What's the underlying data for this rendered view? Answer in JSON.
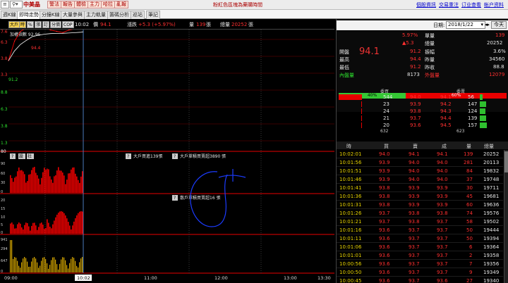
{
  "toolbar": {
    "dropdown_label": "▾",
    "search_icon": "search-icon",
    "stock_name": "中美晶",
    "buttons": [
      "警法",
      "報告",
      "體檢",
      "主力",
      "哈拉",
      "亂報"
    ],
    "marquee": "粉紅色區塊為藥購時間",
    "links": [
      "個股資訊",
      "交易重注",
      "订业查看",
      "帐户资料"
    ]
  },
  "tabs": [
    "週K線",
    "即時走勢",
    "分鐘K線",
    "大量參與",
    "主力軌量",
    "籌碼分析",
    "巡站",
    "筆記"
  ],
  "chart_toolbar": {
    "buttons": [
      "大戶",
      "時",
      "%",
      "漲",
      "訂",
      "分價",
      "COP"
    ],
    "time": "10:02",
    "price_label": "價",
    "price": "94.1",
    "change_label": "漲跌",
    "change": "+5.3 (+5.97%)",
    "volume_label": "量",
    "volume": "139",
    "volume_unit": "張",
    "total_label": "總量",
    "total": "20252",
    "total_unit": "張"
  },
  "chart": {
    "price_scale_labels": [
      "7.6",
      "6.3",
      "3.8",
      "3.3",
      "8.8",
      "6.3",
      "3.8",
      "1.3",
      "80"
    ],
    "weighted_index_label": "加權指數 92.96",
    "high_label": "94.4",
    "low_label": "91.2",
    "panel2_buttons": [
      "?",
      "設",
      "社"
    ],
    "panel2_note1": "大戶買進139張",
    "panel2_note2": "大戶單積買賣超3890 張",
    "panel2_scale": [
      "90",
      "60",
      "30",
      "0"
    ],
    "panel3_note": "散戶單積買賣超16 張",
    "panel3_scale": [
      "20",
      "15",
      "10",
      "5",
      "0"
    ],
    "panel4_scale": [
      "941",
      "294",
      "647",
      "0"
    ],
    "time_labels": [
      "09:00",
      "10:02",
      "11:00",
      "12:00",
      "13:00",
      "13:30"
    ],
    "colors": {
      "accent_red": "#e80000",
      "price_line": "#ffffff",
      "avg_line": "#e8d300"
    }
  },
  "chart_data": {
    "type": "line",
    "title": "",
    "xlabel": "",
    "ylabel": "",
    "series": [
      {
        "name": "price",
        "x": [
          "09:00",
          "09:05",
          "09:10",
          "09:15",
          "09:20",
          "09:25",
          "09:30",
          "09:35",
          "09:40",
          "09:45",
          "09:50",
          "09:55",
          "10:00",
          "10:02"
        ],
        "values": [
          91.2,
          92.8,
          93.6,
          93.9,
          94.4,
          93.8,
          93.9,
          93.7,
          93.6,
          93.5,
          93.7,
          93.8,
          93.9,
          94.1
        ]
      }
    ]
  },
  "right_panel": {
    "date_label": "日期:",
    "date_value": "2018/1/22",
    "today_button": "今天",
    "price": "94.1",
    "pct": "5.97%",
    "change": "▲5.3",
    "single_label": "單量",
    "single_value": "139",
    "total_label": "總量",
    "total_value": "20252",
    "rows": [
      {
        "l1": "開盤",
        "v1": "91.2",
        "l2": "振幅",
        "v2": "3.6%"
      },
      {
        "l1": "最高",
        "v1": "94.4",
        "l2": "昨量",
        "v2": "34560"
      },
      {
        "l1": "最低",
        "v1": "91.2",
        "l2": "昨收",
        "v2": "88.8"
      }
    ],
    "inner_label": "內盤量",
    "inner_value": "8173",
    "outer_label": "外盤量",
    "outer_value": "12079",
    "ratio_green": "40%",
    "ratio_red": "60%",
    "buy_header": "委買",
    "sell_header": "委賣",
    "book": [
      {
        "bq": "544",
        "bp": "94.0",
        "sp": "94.1",
        "sq": "56"
      },
      {
        "bq": "23",
        "bp": "93.9",
        "sp": "94.2",
        "sq": "147"
      },
      {
        "bq": "24",
        "bp": "93.8",
        "sp": "94.3",
        "sq": "124"
      },
      {
        "bq": "21",
        "bp": "93.7",
        "sp": "94.4",
        "sq": "139"
      },
      {
        "bq": "20",
        "bp": "93.6",
        "sp": "94.5",
        "sq": "157"
      }
    ],
    "book_totals": {
      "buy": "632",
      "sell": "623"
    },
    "trade_headers": [
      "時",
      "買",
      "賣",
      "成",
      "量",
      "總量"
    ],
    "trades": [
      {
        "t": "10:02:01",
        "b": "94.0",
        "s": "94.1",
        "p": "94.1",
        "v": "139",
        "tot": "20252"
      },
      {
        "t": "10:01:56",
        "b": "93.9",
        "s": "94.0",
        "p": "94.0",
        "v": "281",
        "tot": "20113"
      },
      {
        "t": "10:01:51",
        "b": "93.9",
        "s": "94.0",
        "p": "94.0",
        "v": "84",
        "tot": "19832"
      },
      {
        "t": "10:01:46",
        "b": "93.9",
        "s": "94.0",
        "p": "94.0",
        "v": "37",
        "tot": "19748"
      },
      {
        "t": "10:01:41",
        "b": "93.8",
        "s": "93.9",
        "p": "93.9",
        "v": "30",
        "tot": "19711"
      },
      {
        "t": "10:01:36",
        "b": "93.8",
        "s": "93.9",
        "p": "93.9",
        "v": "45",
        "tot": "19681"
      },
      {
        "t": "10:01:31",
        "b": "93.8",
        "s": "93.9",
        "p": "93.9",
        "v": "60",
        "tot": "19636"
      },
      {
        "t": "10:01:26",
        "b": "93.7",
        "s": "93.8",
        "p": "93.8",
        "v": "74",
        "tot": "19576"
      },
      {
        "t": "10:01:21",
        "b": "93.7",
        "s": "93.8",
        "p": "93.7",
        "v": "58",
        "tot": "19502"
      },
      {
        "t": "10:01:16",
        "b": "93.6",
        "s": "93.7",
        "p": "93.7",
        "v": "50",
        "tot": "19444"
      },
      {
        "t": "10:01:11",
        "b": "93.6",
        "s": "93.7",
        "p": "93.7",
        "v": "50",
        "tot": "19394"
      },
      {
        "t": "10:01:06",
        "b": "93.6",
        "s": "93.7",
        "p": "93.7",
        "v": "6",
        "tot": "19364"
      },
      {
        "t": "10:01:01",
        "b": "93.6",
        "s": "93.7",
        "p": "93.7",
        "v": "2",
        "tot": "19358"
      },
      {
        "t": "10:00:56",
        "b": "93.6",
        "s": "93.7",
        "p": "93.7",
        "v": "7",
        "tot": "19356"
      },
      {
        "t": "10:00:50",
        "b": "93.6",
        "s": "93.7",
        "p": "93.7",
        "v": "9",
        "tot": "19349"
      },
      {
        "t": "10:00:45",
        "b": "93.6",
        "s": "93.7",
        "p": "93.6",
        "v": "27",
        "tot": "19340"
      },
      {
        "t": "10:00:40",
        "b": "93.6",
        "s": "93.7",
        "p": "93.6",
        "v": "27",
        "tot": "19313"
      }
    ]
  }
}
